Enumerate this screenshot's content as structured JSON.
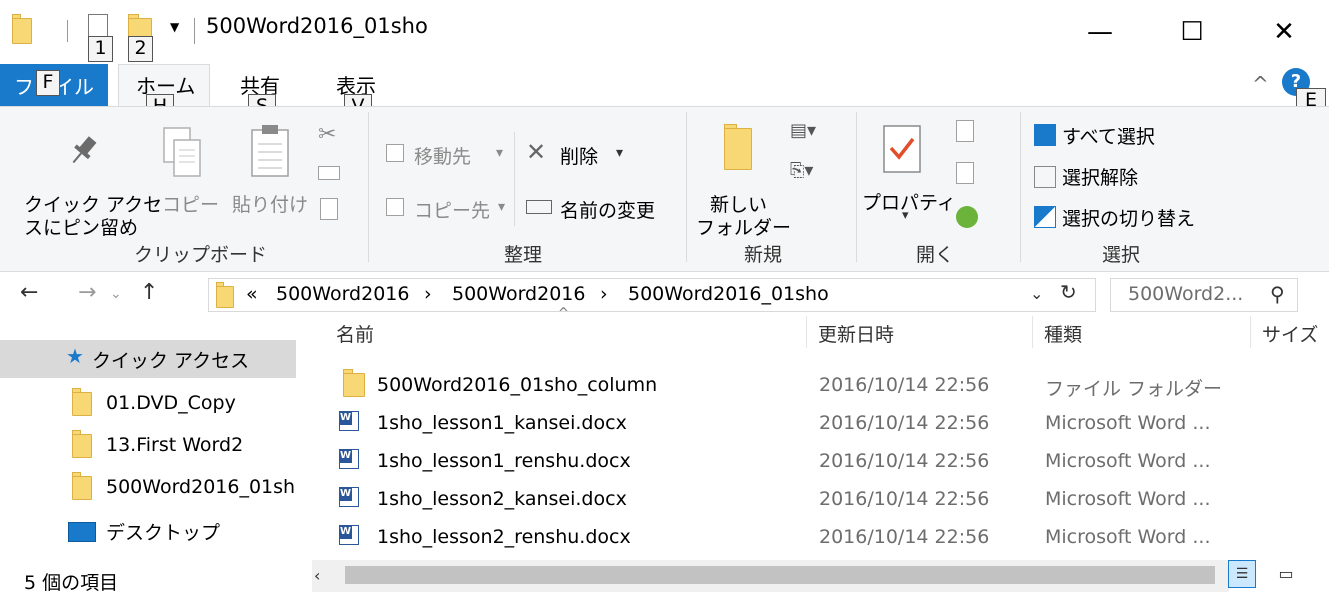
{
  "window": {
    "title": "500Word2016_01sho",
    "qat_dropdown_glyph": "▼",
    "qat_keytips": [
      "1",
      "2"
    ],
    "minimize_glyph": "—",
    "maximize_glyph": "☐",
    "close_glyph": "✕"
  },
  "tabs": {
    "file": {
      "label": "ファイル",
      "keytip": "F"
    },
    "home": {
      "label": "ホーム",
      "keytip": "H"
    },
    "share": {
      "label": "共有",
      "keytip": "S"
    },
    "view": {
      "label": "表示",
      "keytip": "V"
    },
    "collapse_glyph": "^",
    "help_glyph": "?",
    "help_keytip": "E"
  },
  "ribbon": {
    "clipboard": {
      "pin_label_line1": "クイック アクセ",
      "pin_label_line2": "スにピン留め",
      "copy_label": "コピー",
      "paste_label": "貼り付け",
      "group_label": "クリップボード"
    },
    "organize": {
      "move_to_label": "移動先",
      "copy_to_label": "コピー先",
      "delete_label": "削除",
      "rename_label": "名前の変更",
      "group_label": "整理"
    },
    "new": {
      "new_folder_line1": "新しい",
      "new_folder_line2": "フォルダー",
      "group_label": "新規"
    },
    "open": {
      "properties_label": "プロパティ",
      "group_label": "開く"
    },
    "select": {
      "select_all_label": "すべて選択",
      "select_none_label": "選択解除",
      "invert_selection_label": "選択の切り替え",
      "group_label": "選択"
    }
  },
  "address": {
    "overflow_glyph": "«",
    "crumbs": [
      "500Word2016",
      "500Word2016",
      "500Word2016_01sho"
    ],
    "separator_glyph": "›",
    "search_placeholder": "500Word2..."
  },
  "nav_pane": {
    "quick_access_label": "クイック アクセス",
    "items": [
      "01.DVD_Copy",
      "13.First Word2",
      "500Word2016_01sho"
    ],
    "desktop_label": "デスクトップ"
  },
  "columns": {
    "name": "名前",
    "modified": "更新日時",
    "type": "種類",
    "size": "サイズ"
  },
  "files": [
    {
      "name": "500Word2016_01sho_column",
      "modified": "2016/10/14 22:56",
      "type": "ファイル フォルダー",
      "icon": "folder"
    },
    {
      "name": "1sho_lesson1_kansei.docx",
      "modified": "2016/10/14 22:56",
      "type": "Microsoft Word ...",
      "icon": "word"
    },
    {
      "name": "1sho_lesson1_renshu.docx",
      "modified": "2016/10/14 22:56",
      "type": "Microsoft Word ...",
      "icon": "word"
    },
    {
      "name": "1sho_lesson2_kansei.docx",
      "modified": "2016/10/14 22:56",
      "type": "Microsoft Word ...",
      "icon": "word"
    },
    {
      "name": "1sho_lesson2_renshu.docx",
      "modified": "2016/10/14 22:56",
      "type": "Microsoft Word ...",
      "icon": "word"
    }
  ],
  "status": {
    "item_count": "5 個の項目"
  },
  "colors": {
    "file_tab": "#1979ca",
    "ribbon_bg": "#f5f6f7",
    "selected_nav": "#d9d9d9",
    "folder_yellow": "#f8d775",
    "word_blue": "#2b579a"
  }
}
